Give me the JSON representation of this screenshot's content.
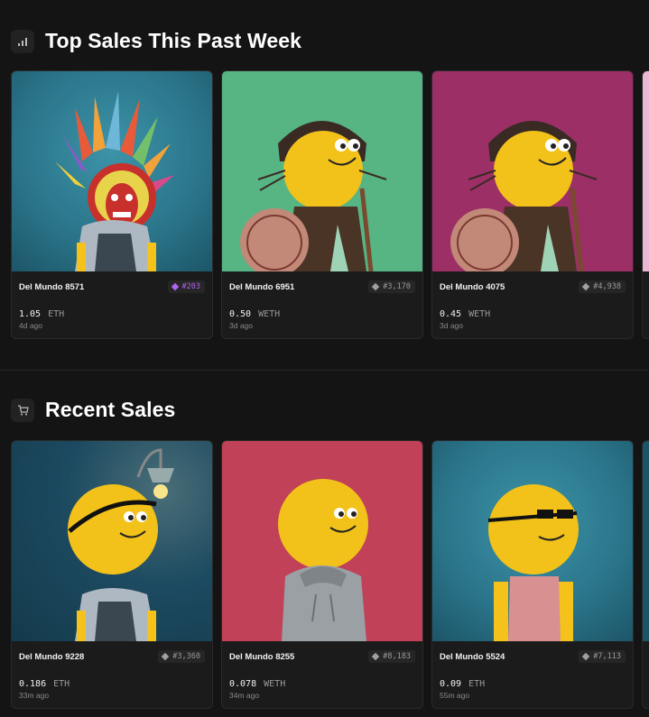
{
  "top_sales": {
    "title": "Top Sales This Past Week",
    "icon": "bar-chart-icon",
    "cards": [
      {
        "name": "Del Mundo 8571",
        "rank": "#203",
        "price": "1.05",
        "currency": "ETH",
        "ago": "4d ago",
        "bg": "#2f7e93",
        "rank_color": "purple"
      },
      {
        "name": "Del Mundo 6951",
        "rank": "#3,170",
        "price": "0.50",
        "currency": "WETH",
        "ago": "3d ago",
        "bg": "#57b584",
        "rank_color": "grey"
      },
      {
        "name": "Del Mundo 4075",
        "rank": "#4,938",
        "price": "0.45",
        "currency": "WETH",
        "ago": "3d ago",
        "bg": "#9c2f66",
        "rank_color": "grey"
      }
    ]
  },
  "recent_sales": {
    "title": "Recent Sales",
    "icon": "cart-icon",
    "cards": [
      {
        "name": "Del Mundo 9228",
        "rank": "#3,360",
        "price": "0.186",
        "currency": "ETH",
        "ago": "33m ago",
        "bg": "#1c4a60",
        "rank_color": "grey"
      },
      {
        "name": "Del Mundo 8255",
        "rank": "#8,183",
        "price": "0.078",
        "currency": "WETH",
        "ago": "34m ago",
        "bg": "#c04158",
        "rank_color": "grey"
      },
      {
        "name": "Del Mundo 5524",
        "rank": "#7,113",
        "price": "0.09",
        "currency": "ETH",
        "ago": "55m ago",
        "bg": "#2f7e93",
        "rank_color": "grey"
      }
    ]
  }
}
